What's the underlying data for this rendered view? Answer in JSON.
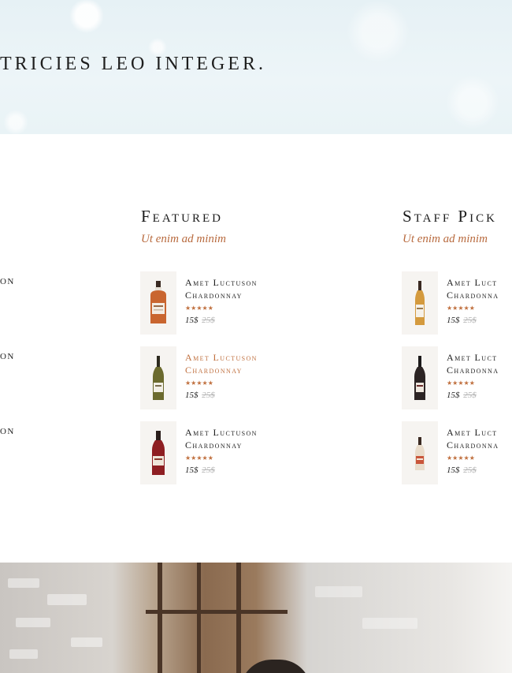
{
  "hero": {
    "title": "TRICIES LEO INTEGER."
  },
  "left_fragments": [
    "ON",
    "ON",
    "ON"
  ],
  "columns": [
    {
      "heading": "Featured",
      "subtitle": "Ut enim ad minim",
      "products": [
        {
          "name_line1": "Amet Luctuson",
          "name_line2": "Chardonnay",
          "rating": "★★★★★",
          "price": "15$",
          "old_price": "25$",
          "bottle": "amber-square-bottle-icon",
          "highlighted": false
        },
        {
          "name_line1": "Amet Luctuson",
          "name_line2": "Chardonnay",
          "rating": "★★★★★",
          "price": "15$",
          "old_price": "25$",
          "bottle": "white-wine-bottle-icon",
          "highlighted": true
        },
        {
          "name_line1": "Amet Luctuson",
          "name_line2": "Chardonnay",
          "rating": "★★★★★",
          "price": "15$",
          "old_price": "25$",
          "bottle": "red-liqueur-bottle-icon",
          "highlighted": false
        }
      ]
    },
    {
      "heading": "Staff Pick",
      "subtitle": "Ut enim ad minim",
      "products": [
        {
          "name_line1": "Amet Luct",
          "name_line2": "Chardonna",
          "rating": "★★★★★",
          "price": "15$",
          "old_price": "25$",
          "bottle": "whisky-bottle-icon",
          "highlighted": false
        },
        {
          "name_line1": "Amet Luct",
          "name_line2": "Chardonna",
          "rating": "★★★★★",
          "price": "15$",
          "old_price": "25$",
          "bottle": "red-wine-bottle-icon",
          "highlighted": false
        },
        {
          "name_line1": "Amet Luct",
          "name_line2": "Chardonna",
          "rating": "★★★★★",
          "price": "15$",
          "old_price": "25$",
          "bottle": "small-liqueur-bottle-icon",
          "highlighted": false
        }
      ]
    }
  ],
  "colors": {
    "accent": "#c0703f",
    "heading": "#1b1b1b",
    "muted_price": "#b3b3b3",
    "hero_bg": "#e9f3f6",
    "thumb_bg": "#f6f4f1"
  }
}
